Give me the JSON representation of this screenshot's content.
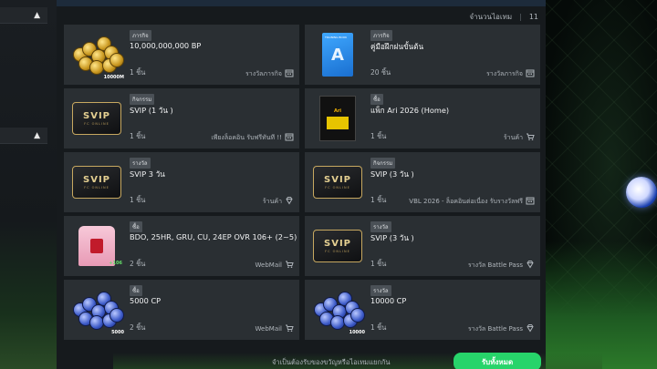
{
  "header": {
    "count_label": "จำนวนไอเทม",
    "count_value": "11"
  },
  "side_tabs": [
    "▲",
    "▲"
  ],
  "items": [
    {
      "badge": "ภารกิจ",
      "title": "10,000,000,000 BP",
      "qty": "1 ชิ้น",
      "source": "รางวัลภารกิจ",
      "source_icon": "calendar-icon",
      "thumb": "bp-coins",
      "thumb_label": "10000M"
    },
    {
      "badge": "ภารกิจ",
      "title": "คู่มือฝึกฝนขั้นต้น",
      "qty": "20 ชิ้น",
      "source": "รางวัลภารกิจ",
      "source_icon": "calendar-icon",
      "thumb": "training-book",
      "thumb_label": "TRAINING BOOK"
    },
    {
      "badge": "กิจกรรม",
      "title": "SVIP (1 วัน )",
      "qty": "1 ชิ้น",
      "source": "เพียงล็อคอิน รับฟรีทันที !!",
      "source_icon": "calendar-icon",
      "thumb": "svip"
    },
    {
      "badge": "ซื้อ",
      "title": "แพ็ก Ari 2026 (Home)",
      "qty": "1 ชิ้น",
      "source": "ร้านค้า",
      "source_icon": "cart-icon",
      "thumb": "ari-pack",
      "thumb_label": "Ari"
    },
    {
      "badge": "รางวัล",
      "title": "SVIP 3 วัน",
      "qty": "1 ชิ้น",
      "source": "ร้านค้า",
      "source_icon": "diamond-icon",
      "thumb": "svip"
    },
    {
      "badge": "กิจกรรม",
      "title": "SVIP (3 วัน )",
      "qty": "1 ชิ้น",
      "source": "VBL 2026 - ล็อคอินต่อเนื่อง รับรางวัลฟรี",
      "source_icon": "calendar-icon",
      "thumb": "svip"
    },
    {
      "badge": "ซื้อ",
      "title": "BDO, 25HR, GRU, CU, 24EP OVR 106+ (2~5)",
      "qty": "2 ชิ้น",
      "source": "WebMail",
      "source_icon": "cart-icon",
      "thumb": "shirt",
      "thumb_label": "+106"
    },
    {
      "badge": "รางวัล",
      "title": "SVIP (3 วัน )",
      "qty": "1 ชิ้น",
      "source": "รางวัล Battle Pass",
      "source_icon": "diamond-icon",
      "thumb": "svip"
    },
    {
      "badge": "ซื้อ",
      "title": "5000 CP",
      "qty": "2 ชิ้น",
      "source": "WebMail",
      "source_icon": "cart-icon",
      "thumb": "cp-coins",
      "thumb_label": "5000"
    },
    {
      "badge": "รางวัล",
      "title": "10000 CP",
      "qty": "1 ชิ้น",
      "source": "รางวัล Battle Pass",
      "source_icon": "diamond-icon",
      "thumb": "cp-coins",
      "thumb_label": "10000"
    }
  ],
  "svip_text": {
    "main": "SVIP",
    "sub": "FC ONLINE"
  },
  "footer": {
    "note": "จำเป็นต้องรับของขวัญหรือไอเทมแยกกัน",
    "claim_all": "รับทั้งหมด"
  },
  "colors": {
    "accent": "#27d46a",
    "card_bg": "#2a2f33",
    "panel_bg": "#161a1d"
  }
}
